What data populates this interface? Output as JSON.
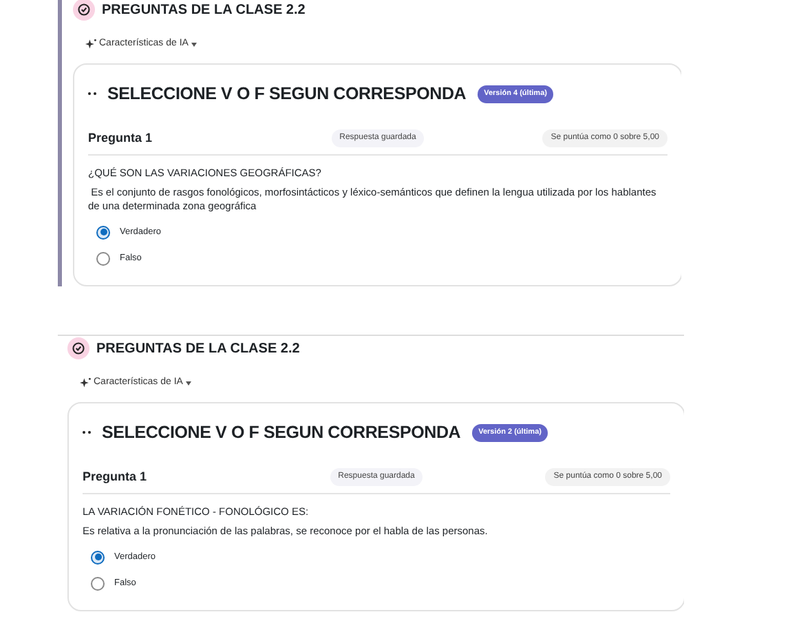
{
  "sections": [
    {
      "kind": "accent",
      "title": "PREGUNTAS DE LA CLASE 2.2",
      "ai_label": "Características de IA",
      "card": {
        "heading": "SELECCIONE V O F SEGUN CORRESPONDA",
        "version": "Versión 4 (última)",
        "question_label": "Pregunta 1",
        "status": "Respuesta guardada",
        "grade": "Se puntúa como 0 sobre 5,00",
        "prompt": "¿QUÉ SON LAS VARIACIONES GEOGRÁFICAS?",
        "statement": " Es el conjunto de rasgos fonológicos, morfosintácticos y léxico-semánticos que definen la lengua utilizada por los hablantes de una determinada zona geográfica",
        "options": [
          {
            "label": "Verdadero",
            "selected": true
          },
          {
            "label": "Falso",
            "selected": false
          }
        ]
      }
    },
    {
      "kind": "divided",
      "title": "PREGUNTAS DE LA CLASE 2.2",
      "ai_label": "Características de IA",
      "card": {
        "heading": "SELECCIONE V O F SEGUN CORRESPONDA",
        "version": "Versión 2 (última)",
        "question_label": "Pregunta 1",
        "status": "Respuesta guardada",
        "grade": "Se puntúa como 0 sobre 5,00",
        "prompt": "LA VARIACIÓN FONÉTICO - FONOLÓGICO ES:",
        "statement": "Es relativa a la pronunciación de las palabras, se reconoce por el habla de las personas.",
        "options": [
          {
            "label": "Verdadero",
            "selected": true
          },
          {
            "label": "Falso",
            "selected": false
          }
        ]
      }
    }
  ]
}
